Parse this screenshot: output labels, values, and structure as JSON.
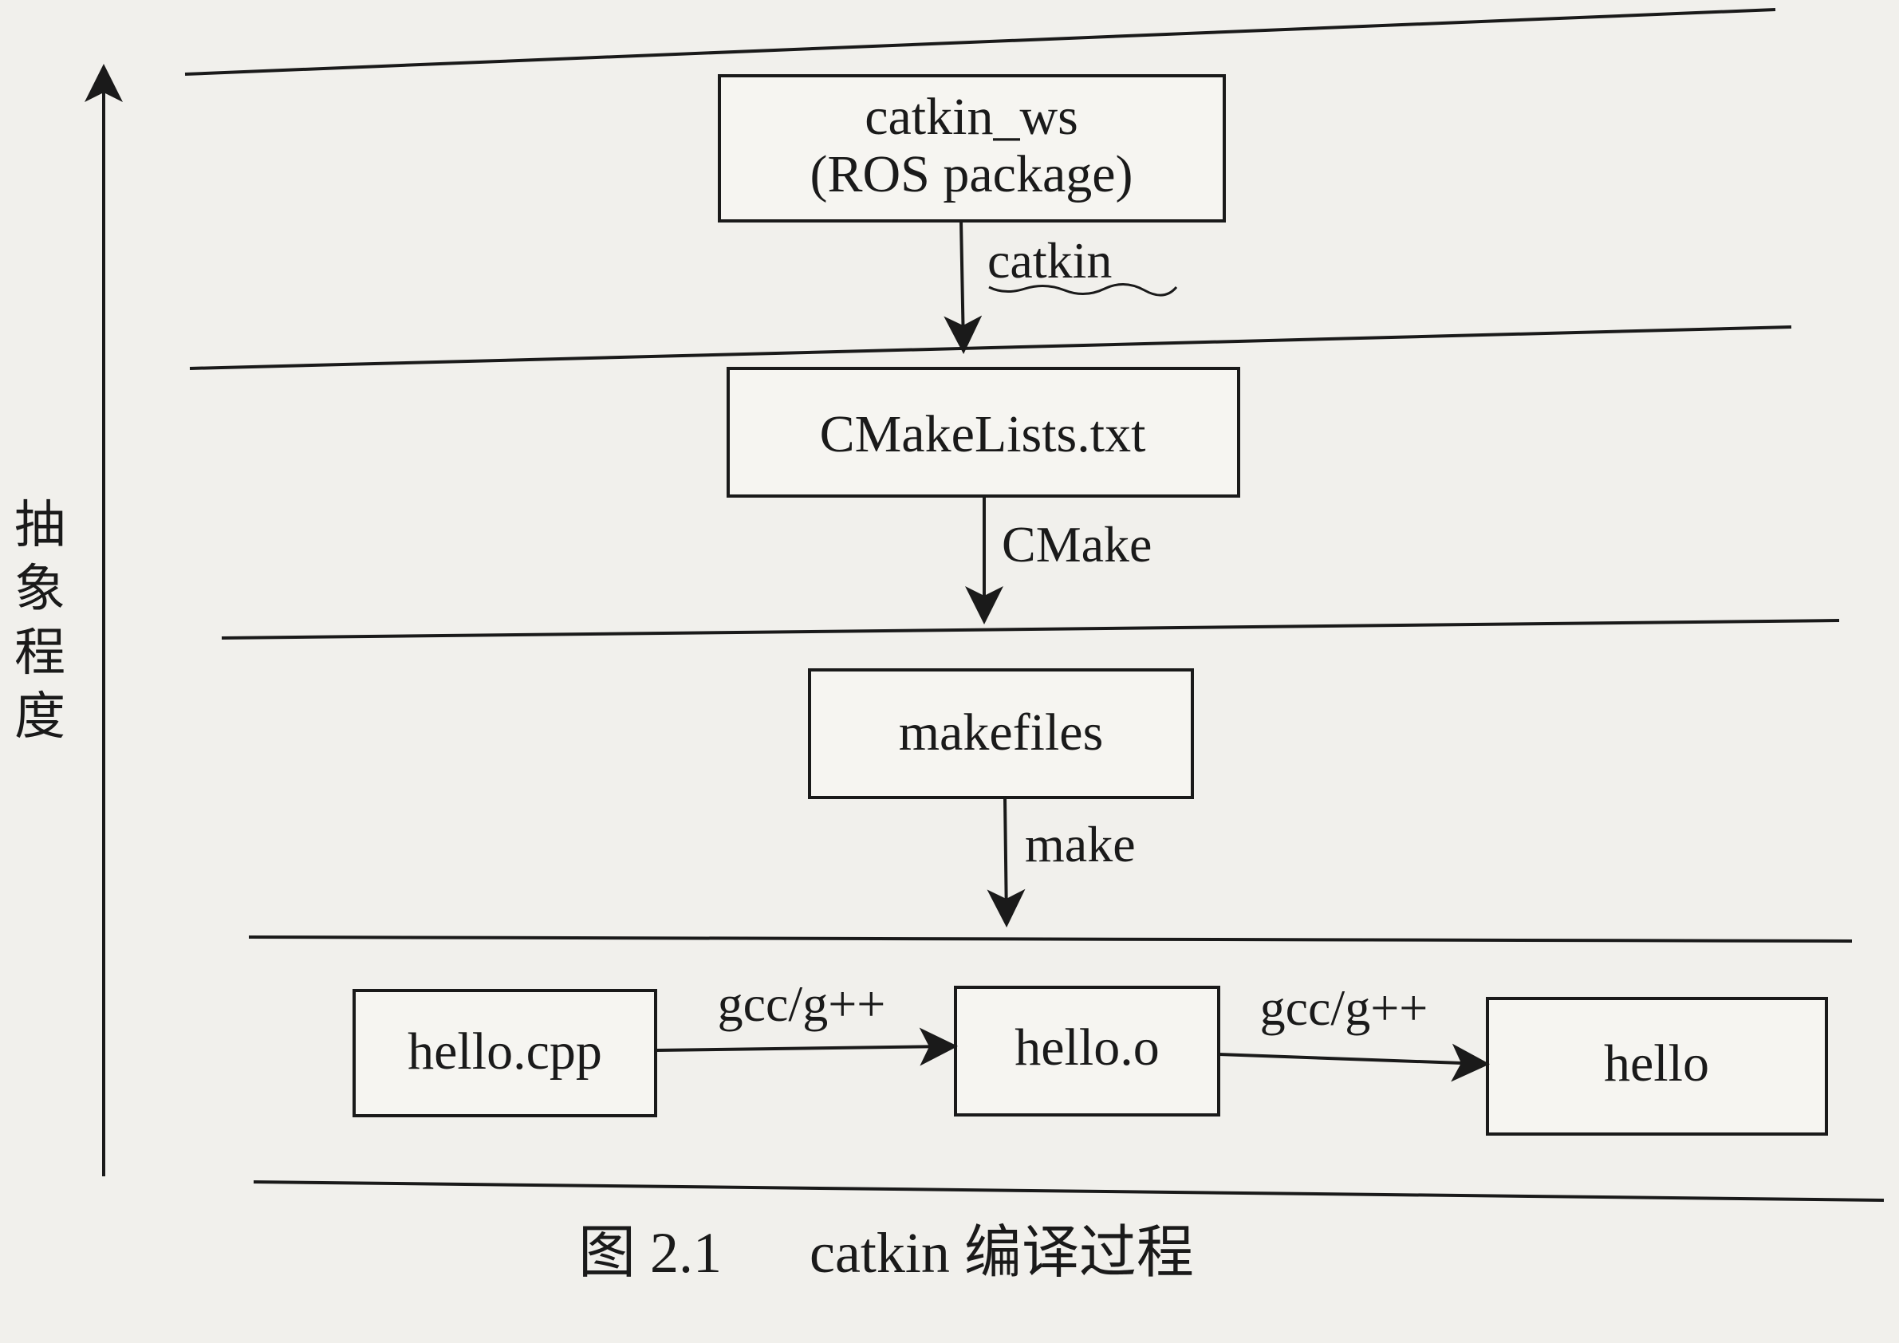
{
  "axis": {
    "label_chars": [
      "抽",
      "象",
      "程",
      "度"
    ]
  },
  "nodes": {
    "catkin_ws": {
      "line1": "catkin_ws",
      "line2": "(ROS package)"
    },
    "cmakelists": {
      "label": "CMakeLists.txt"
    },
    "makefiles": {
      "label": "makefiles"
    },
    "hello_cpp": {
      "label": "hello.cpp"
    },
    "hello_o": {
      "label": "hello.o"
    },
    "hello": {
      "label": "hello"
    }
  },
  "edges": {
    "catkin": "catkin",
    "cmake": "CMake",
    "make": "make",
    "gcc1": "gcc/g++",
    "gcc2": "gcc/g++"
  },
  "caption": {
    "figure_no": "图 2.1",
    "title": "catkin 编译过程"
  },
  "colors": {
    "paper": "#f1f0ec",
    "ink": "#1a1a1a"
  }
}
